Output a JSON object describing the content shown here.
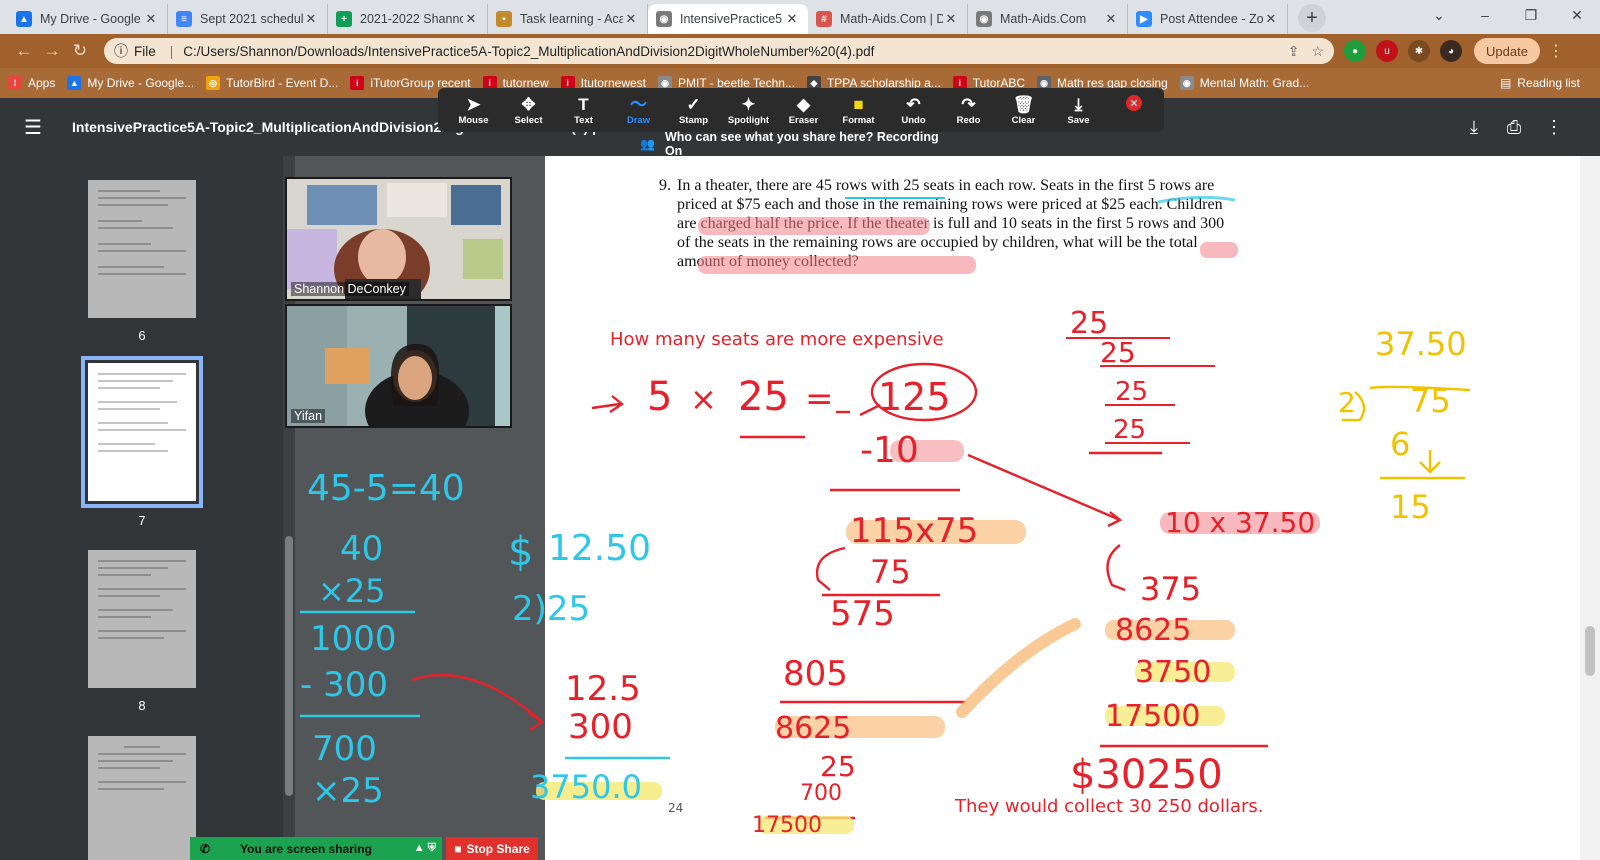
{
  "tabs": [
    {
      "label": "My Drive - Google",
      "icon": "google-drive-icon",
      "color": "#1a73e8",
      "glyph": "▲"
    },
    {
      "label": "Sept 2021 schedule",
      "icon": "google-docs-icon",
      "color": "#4285f4",
      "glyph": "≡"
    },
    {
      "label": "2021-2022 Shanno",
      "icon": "google-sheets-icon",
      "color": "#0f9d58",
      "glyph": "+"
    },
    {
      "label": "Task learning - Aca",
      "icon": "document-icon",
      "color": "#c28a2b",
      "glyph": "▪"
    },
    {
      "label": "IntensivePractice5",
      "icon": "globe-icon",
      "color": "#7a7a7a",
      "glyph": "◉"
    },
    {
      "label": "Math-Aids.Com | D",
      "icon": "math-aids-icon",
      "color": "#d9534f",
      "glyph": "#"
    },
    {
      "label": "Math-Aids.Com",
      "icon": "globe-icon",
      "color": "#7a7a7a",
      "glyph": "◉"
    },
    {
      "label": "Post Attendee - Zo",
      "icon": "zoom-icon",
      "color": "#2d8cff",
      "glyph": "▶"
    }
  ],
  "address": {
    "scheme_label": "File",
    "url": "C:/Users/Shannon/Downloads/IntensivePractice5A-Topic2_MultiplicationAndDivision2DigitWholeNumber%20(4).pdf",
    "update_label": "Update"
  },
  "bookmarks": [
    {
      "label": "Apps",
      "color": "#e8453c",
      "glyph": "⁞"
    },
    {
      "label": "My Drive - Google...",
      "color": "#1a73e8",
      "glyph": "▲"
    },
    {
      "label": "TutorBird - Event D...",
      "color": "#f0a30a",
      "glyph": "◎"
    },
    {
      "label": "iTutorGroup recent",
      "color": "#d0021b",
      "glyph": "i"
    },
    {
      "label": "tutornew",
      "color": "#d0021b",
      "glyph": "i"
    },
    {
      "label": "Itutornewest",
      "color": "#d0021b",
      "glyph": "i"
    },
    {
      "label": "PMIT - beetle Techn...",
      "color": "#8a8a8a",
      "glyph": "◉"
    },
    {
      "label": "TPPA scholarship a...",
      "color": "#444444",
      "glyph": "◆"
    },
    {
      "label": "TutorABC",
      "color": "#d0021b",
      "glyph": "i"
    },
    {
      "label": "Math res gap closing",
      "color": "#5f6368",
      "glyph": "◉"
    },
    {
      "label": "Mental Math: Grad...",
      "color": "#8a8a8a",
      "glyph": "◉"
    }
  ],
  "reading_list_label": "Reading list",
  "pdf": {
    "title": "IntensivePractice5A-Topic2_MultiplicationAndDivision2DigitWholeNumber (4).pdf",
    "pages": [
      {
        "number": "6"
      },
      {
        "number": "7"
      },
      {
        "number": "8"
      }
    ],
    "current_page": "7"
  },
  "zoom_toolbar": {
    "tools": [
      {
        "label": "Mouse",
        "icon": "mouse-pointer-icon",
        "glyph": "➤"
      },
      {
        "label": "Select",
        "icon": "move-icon",
        "glyph": "✥"
      },
      {
        "label": "Text",
        "icon": "text-icon",
        "glyph": "T"
      },
      {
        "label": "Draw",
        "icon": "draw-squiggle-icon",
        "glyph": "〜"
      },
      {
        "label": "Stamp",
        "icon": "checkmark-stamp-icon",
        "glyph": "✓"
      },
      {
        "label": "Spotlight",
        "icon": "spotlight-wand-icon",
        "glyph": "✦"
      },
      {
        "label": "Eraser",
        "icon": "eraser-icon",
        "glyph": "◆"
      },
      {
        "label": "Format",
        "icon": "format-color-icon",
        "glyph": "■"
      },
      {
        "label": "Undo",
        "icon": "undo-icon",
        "glyph": "↶"
      },
      {
        "label": "Redo",
        "icon": "redo-icon",
        "glyph": "↷"
      },
      {
        "label": "Clear",
        "icon": "trash-icon",
        "glyph": "🗑"
      },
      {
        "label": "Save",
        "icon": "save-download-icon",
        "glyph": "⤓"
      }
    ],
    "active_tool": "Draw",
    "banner": "Who can see what you share here? Recording On"
  },
  "problem": {
    "number": "9.",
    "text": "In a theater, there are 45 rows with 25 seats in each row. Seats in the first 5 rows are priced at $75 each and those in the remaining rows were priced at $25 each. Children are charged half the price. If the theater is full and 10 seats in the first 5 rows and 300 of the seats in the remaining rows are occupied by children, what will be the total amount of money collected?"
  },
  "annotations": {
    "question": "How many seats are more expensive",
    "answer": "They would collect 30 250 dollars.",
    "page_number_text": "24"
  },
  "participants": [
    {
      "name": "Shannon DeConkey"
    },
    {
      "name": "Yifan"
    }
  ],
  "sharing": {
    "status": "You are screen sharing",
    "stop_label": "Stop Share"
  },
  "colors": {
    "ink_red": "#e8202a",
    "ink_cyan": "#2ec7e8",
    "ink_yellow": "#f2c200",
    "highlight_orange": "#f7b46a",
    "highlight_pink": "#f07f86",
    "highlight_yellow": "#f5ea7a",
    "chrome_theme": "#a0612c"
  }
}
